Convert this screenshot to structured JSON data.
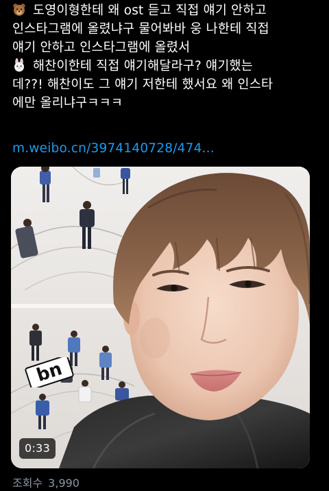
{
  "tweet": {
    "lines": [
      "도영이형한테 왜 ost 듣고 직접 얘기 안하고",
      "인스타그램에 올렸냐구 물어봐바 웅 나한테 직접",
      "얘기 안하고 인스타그램에 올렸서",
      "해찬이한테 직접 얘기해달라구? 얘기했는",
      "데??! 해찬이도 그 얘기 저한테 했서요 왜 인스타",
      "에만 올리냐구ㅋㅋㅋ"
    ],
    "emoji_1": "bear-face",
    "emoji_2": "rabbit-face",
    "link": "m.weibo.cn/3974140728/474..."
  },
  "media": {
    "sticker_text": "bn",
    "duration": "0:33"
  },
  "footer": {
    "views_label": "조회수",
    "views_count": "3,990"
  },
  "colors": {
    "background": "#000000",
    "text": "#ffffff",
    "link": "#1d9bf0",
    "muted": "#8b98a5"
  }
}
